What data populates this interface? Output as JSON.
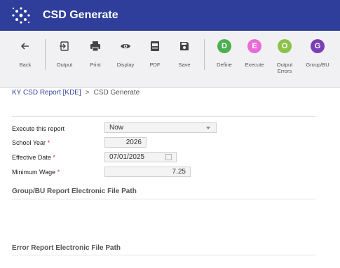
{
  "app": {
    "title": "CSD Generate"
  },
  "toolbar": {
    "back": "Back",
    "output": "Output",
    "print": "Print",
    "display": "Display",
    "pdf": "PDF",
    "save": "Save",
    "define": {
      "letter": "D",
      "label": "Define"
    },
    "execute": {
      "letter": "E",
      "label": "Execute"
    },
    "output_errors": {
      "letter": "O",
      "label": "Output Errors"
    },
    "group_bu": {
      "letter": "G",
      "label": "Group/BU"
    }
  },
  "breadcrumb": {
    "parent": "KY CSD Report [KDE]",
    "separator": ">",
    "current": "CSD Generate"
  },
  "form": {
    "execute_label": "Execute this report",
    "execute_value": "Now",
    "school_year_label": "School Year",
    "school_year_value": "2026",
    "effective_date_label": "Effective Date",
    "effective_date_value": "07/01/2025",
    "min_wage_label": "Minimum Wage",
    "min_wage_value": "7.25",
    "required_mark": "*"
  },
  "sections": {
    "group_path": "Group/BU Report Electronic File Path",
    "error_path": "Error Report Electronic File Path"
  },
  "colors": {
    "header": "#2e3e9a",
    "define": "#4caf50",
    "execute": "#e96ad9",
    "output_errors": "#8bc34a",
    "group_bu": "#7b3fb5"
  }
}
